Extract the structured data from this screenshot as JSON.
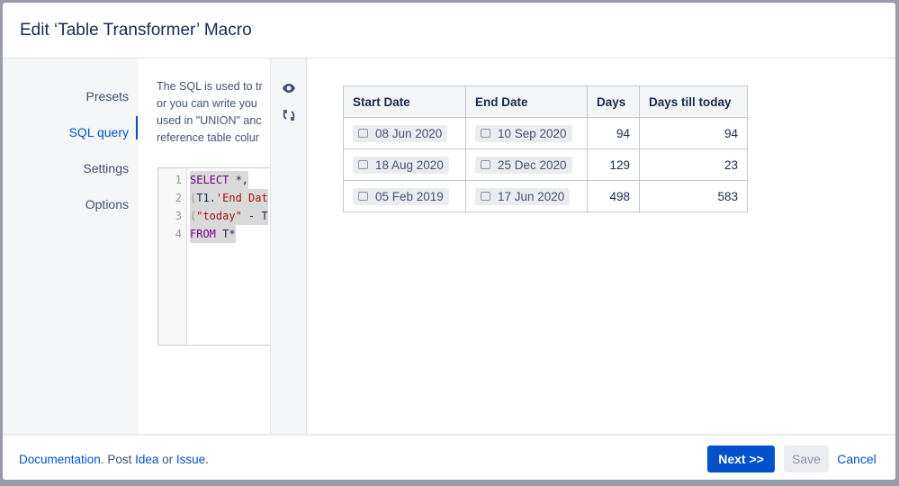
{
  "dialog": {
    "title": "Edit ‘Table Transformer’ Macro"
  },
  "nav": {
    "items": [
      {
        "label": "Presets"
      },
      {
        "label": "SQL query"
      },
      {
        "label": "Settings"
      },
      {
        "label": "Options"
      }
    ],
    "active": "SQL query"
  },
  "description": [
    "The SQL is used to tr",
    "or you can write you",
    "used in \"UNION\" anc",
    "reference table colur"
  ],
  "editor": {
    "line_numbers": [
      "1",
      "2",
      "3",
      "4"
    ],
    "lines": [
      [
        "SELECT",
        " *,"
      ],
      [
        "(",
        "T1.",
        "'End Dat"
      ],
      [
        "(",
        "\"today\"",
        " - T"
      ],
      [
        "FROM",
        " T*"
      ]
    ]
  },
  "icons": [
    "eye-icon",
    "refresh-icon"
  ],
  "table": {
    "headers": [
      "Start Date",
      "End Date",
      "Days",
      "Days till today"
    ],
    "rows": [
      [
        "08 Jun 2020",
        "10 Sep 2020",
        "94",
        "94"
      ],
      [
        "18 Aug 2020",
        "25 Dec 2020",
        "129",
        "23"
      ],
      [
        "05 Feb 2019",
        "17 Jun 2020",
        "498",
        "583"
      ]
    ]
  },
  "footer": {
    "documentation": "Documentation",
    "post": ". Post ",
    "idea": "Idea",
    "or": " or ",
    "issue": "Issue",
    "end": ".",
    "next": "Next >>",
    "save": "Save",
    "cancel": "Cancel"
  },
  "colors": {
    "accent": "#0052cc"
  }
}
